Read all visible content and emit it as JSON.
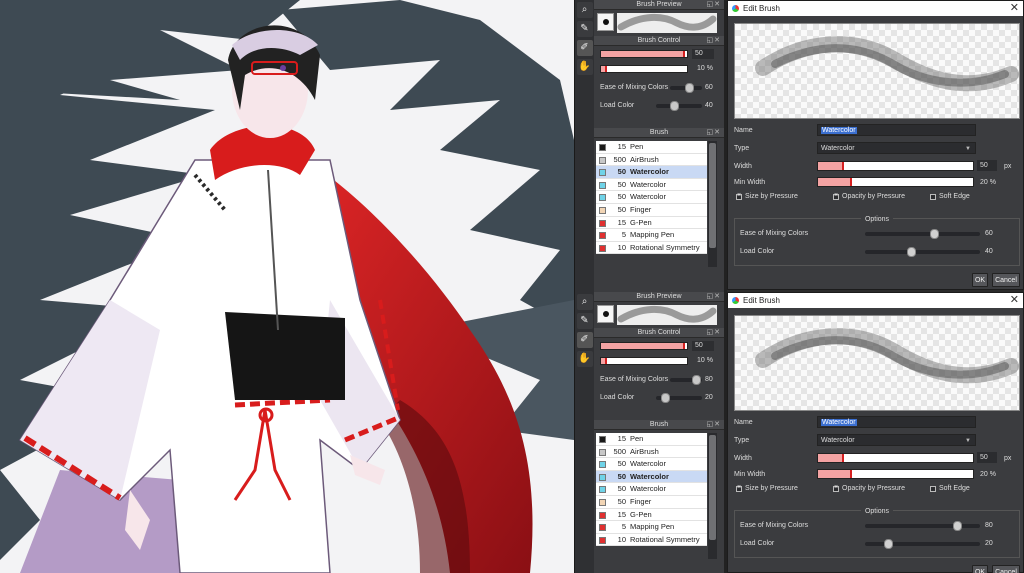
{
  "tool_icons": [
    "lasso-icon",
    "eyedropper-icon",
    "pen-tool-icon",
    "hand-icon"
  ],
  "panels": [
    {
      "brush_preview_title": "Brush Preview",
      "brush_control_title": "Brush Control",
      "size_value": "50",
      "size_fraction": 0.97,
      "opacity_value": "10",
      "opacity_unit": "%",
      "opacity_fraction": 0.06,
      "mixing_label": "Ease of Mixing Colors",
      "mixing_value": "60",
      "load_label": "Load Color",
      "load_value": "40",
      "brush_title": "Brush",
      "brushes": [
        {
          "size": "15",
          "name": "Pen",
          "color": "#1a1a1a",
          "selected": false
        },
        {
          "size": "500",
          "name": "AirBrush",
          "color": "#c8c8c8",
          "selected": false
        },
        {
          "size": "50",
          "name": "Watercolor",
          "color": "#6fd3e8",
          "selected": true
        },
        {
          "size": "50",
          "name": "Watercolor",
          "color": "#6fd3e8",
          "selected": false
        },
        {
          "size": "50",
          "name": "Watercolor",
          "color": "#6fd3e8",
          "selected": false
        },
        {
          "size": "50",
          "name": "Finger",
          "color": "#f2d5b5",
          "selected": false
        },
        {
          "size": "15",
          "name": "G-Pen",
          "color": "#e03030",
          "selected": false
        },
        {
          "size": "5",
          "name": "Mapping Pen",
          "color": "#e03030",
          "selected": false
        },
        {
          "size": "10",
          "name": "Rotational Symmetry",
          "color": "#e03030",
          "selected": false
        }
      ]
    },
    {
      "brush_preview_title": "Brush Preview",
      "brush_control_title": "Brush Control",
      "size_value": "50",
      "size_fraction": 0.97,
      "opacity_value": "10",
      "opacity_unit": "%",
      "opacity_fraction": 0.06,
      "mixing_label": "Ease of Mixing Colors",
      "mixing_value": "80",
      "load_label": "Load Color",
      "load_value": "20",
      "brush_title": "Brush",
      "brushes": [
        {
          "size": "15",
          "name": "Pen",
          "color": "#1a1a1a",
          "selected": false
        },
        {
          "size": "500",
          "name": "AirBrush",
          "color": "#c8c8c8",
          "selected": false
        },
        {
          "size": "50",
          "name": "Watercolor",
          "color": "#6fd3e8",
          "selected": false
        },
        {
          "size": "50",
          "name": "Watercolor",
          "color": "#6fd3e8",
          "selected": true
        },
        {
          "size": "50",
          "name": "Watercolor",
          "color": "#6fd3e8",
          "selected": false
        },
        {
          "size": "50",
          "name": "Finger",
          "color": "#f2d5b5",
          "selected": false
        },
        {
          "size": "15",
          "name": "G-Pen",
          "color": "#e03030",
          "selected": false
        },
        {
          "size": "5",
          "name": "Mapping Pen",
          "color": "#e03030",
          "selected": false
        },
        {
          "size": "10",
          "name": "Rotational Symmetry",
          "color": "#e03030",
          "selected": false
        }
      ]
    }
  ],
  "dialogs": [
    {
      "title": "Edit Brush",
      "name_label": "Name",
      "name_value": "Watercolor",
      "type_label": "Type",
      "type_value": "Watercolor",
      "width_label": "Width",
      "width_value": "50",
      "width_unit": "px",
      "width_fraction": 0.16,
      "min_width_label": "Min Width",
      "min_width_value": "20",
      "min_width_unit": "%",
      "min_width_fraction": 0.21,
      "size_by_pressure": "Size by Pressure",
      "size_by_pressure_on": true,
      "opacity_by_pressure": "Opacity by Pressure",
      "opacity_by_pressure_on": true,
      "soft_edge": "Soft Edge",
      "soft_edge_on": false,
      "options_label": "Options",
      "mixing_label": "Ease of Mixing Colors",
      "mixing_value": "60",
      "load_label": "Load Color",
      "load_value": "40",
      "ok_label": "OK",
      "cancel_label": "Cancel"
    },
    {
      "title": "Edit Brush",
      "name_label": "Name",
      "name_value": "Watercolor",
      "type_label": "Type",
      "type_value": "Watercolor",
      "width_label": "Width",
      "width_value": "50",
      "width_unit": "px",
      "width_fraction": 0.16,
      "min_width_label": "Min Width",
      "min_width_value": "20",
      "min_width_unit": "%",
      "min_width_fraction": 0.21,
      "size_by_pressure": "Size by Pressure",
      "size_by_pressure_on": true,
      "opacity_by_pressure": "Opacity by Pressure",
      "opacity_by_pressure_on": true,
      "soft_edge": "Soft Edge",
      "soft_edge_on": false,
      "options_label": "Options",
      "mixing_label": "Ease of Mixing Colors",
      "mixing_value": "80",
      "load_label": "Load Color",
      "load_value": "20",
      "ok_label": "OK",
      "cancel_label": "Cancel"
    }
  ],
  "colors": {
    "accent_red": "#d62020",
    "slider_fill": "#f4a3a3",
    "selection_blue": "#c9d9f4",
    "panel_bg": "#3b3c3f"
  }
}
